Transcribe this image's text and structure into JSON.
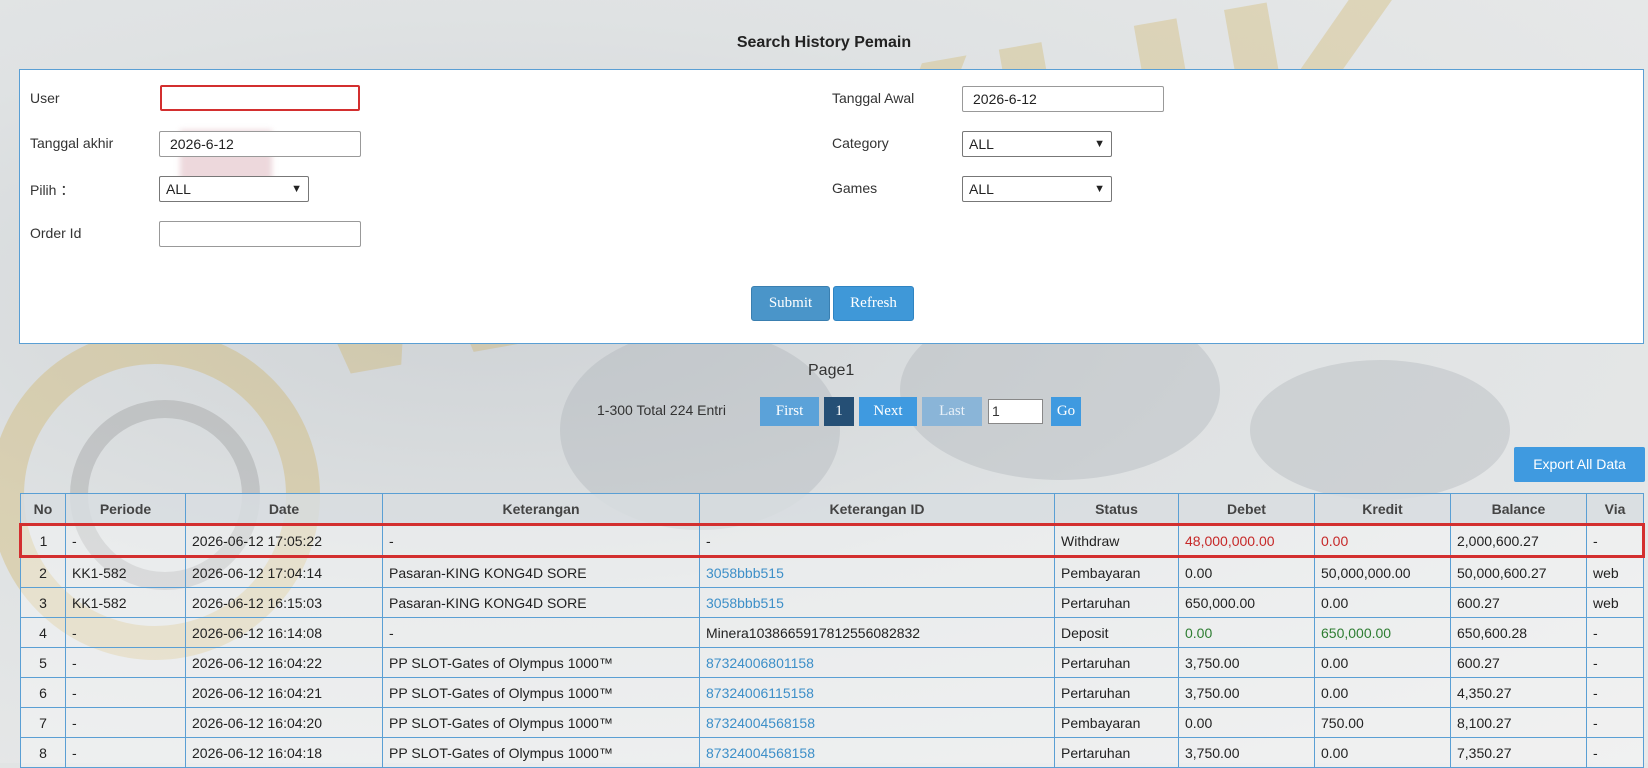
{
  "page": {
    "title": "Search History Pemain"
  },
  "form": {
    "user": {
      "label": "User",
      "value": ""
    },
    "tanggal_awal": {
      "label": "Tanggal Awal",
      "value": "2026-6-12"
    },
    "tanggal_akhir": {
      "label": "Tanggal akhir",
      "value": "2026-6-12"
    },
    "category": {
      "label": "Category",
      "value": "ALL"
    },
    "pilih": {
      "label": "Pilih ：",
      "value": "ALL"
    },
    "games": {
      "label": "Games",
      "value": "ALL"
    },
    "order_id": {
      "label": "Order Id",
      "value": ""
    },
    "submit_label": "Submit",
    "refresh_label": "Refresh"
  },
  "pagination": {
    "page_label": "Page1",
    "entries": "1-300 Total 224 Entri",
    "first": "First",
    "current": "1",
    "next": "Next",
    "last": "Last",
    "input_value": "1",
    "go": "Go"
  },
  "export_label": "Export All Data",
  "watermark": "WDYUK",
  "colors": {
    "accent": "#3f9ae0",
    "highlight": "#d32f2f",
    "debit_red": "#c62828",
    "credit_green": "#2e7d32",
    "link": "#3d8fc8"
  },
  "table": {
    "headers": [
      "No",
      "Periode",
      "Date",
      "Keterangan",
      "Keterangan ID",
      "Status",
      "Debet",
      "Kredit",
      "Balance",
      "Via"
    ],
    "rows": [
      [
        "1",
        "-",
        "2026-06-12 17:05:22",
        "-",
        "-",
        "Withdraw",
        "48,000,000.00",
        "0.00",
        "2,000,600.27",
        "-"
      ],
      [
        "2",
        "KK1-582",
        "2026-06-12 17:04:14",
        "Pasaran-KING KONG4D SORE",
        "3058bbb515",
        "Pembayaran",
        "0.00",
        "50,000,000.00",
        "50,000,600.27",
        "web"
      ],
      [
        "3",
        "KK1-582",
        "2026-06-12 16:15:03",
        "Pasaran-KING KONG4D SORE",
        "3058bbb515",
        "Pertaruhan",
        "650,000.00",
        "0.00",
        "600.27",
        "web"
      ],
      [
        "4",
        "-",
        "2026-06-12 16:14:08",
        "-",
        "Minera1038665917812556082832",
        "Deposit",
        "0.00",
        "650,000.00",
        "650,600.28",
        "-"
      ],
      [
        "5",
        "-",
        "2026-06-12 16:04:22",
        "PP SLOT-Gates of Olympus 1000™",
        "87324006801158",
        "Pertaruhan",
        "3,750.00",
        "0.00",
        "600.27",
        "-"
      ],
      [
        "6",
        "-",
        "2026-06-12 16:04:21",
        "PP SLOT-Gates of Olympus 1000™",
        "87324006115158",
        "Pertaruhan",
        "3,750.00",
        "0.00",
        "4,350.27",
        "-"
      ],
      [
        "7",
        "-",
        "2026-06-12 16:04:20",
        "PP SLOT-Gates of Olympus 1000™",
        "87324004568158",
        "Pembayaran",
        "0.00",
        "750.00",
        "8,100.27",
        "-"
      ],
      [
        "8",
        "-",
        "2026-06-12 16:04:18",
        "PP SLOT-Gates of Olympus 1000™",
        "87324004568158",
        "Pertaruhan",
        "3,750.00",
        "0.00",
        "7,350.27",
        "-"
      ]
    ]
  }
}
